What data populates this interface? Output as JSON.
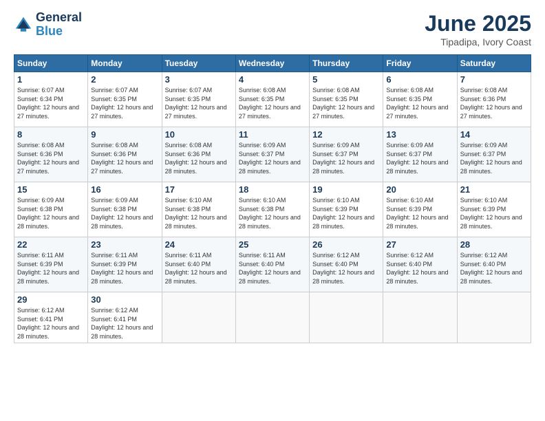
{
  "logo": {
    "line1": "General",
    "line2": "Blue"
  },
  "title": "June 2025",
  "subtitle": "Tipadipa, Ivory Coast",
  "days_of_week": [
    "Sunday",
    "Monday",
    "Tuesday",
    "Wednesday",
    "Thursday",
    "Friday",
    "Saturday"
  ],
  "weeks": [
    [
      {
        "day": "1",
        "sunrise": "6:07 AM",
        "sunset": "6:34 PM",
        "daylight": "12 hours and 27 minutes."
      },
      {
        "day": "2",
        "sunrise": "6:07 AM",
        "sunset": "6:35 PM",
        "daylight": "12 hours and 27 minutes."
      },
      {
        "day": "3",
        "sunrise": "6:07 AM",
        "sunset": "6:35 PM",
        "daylight": "12 hours and 27 minutes."
      },
      {
        "day": "4",
        "sunrise": "6:08 AM",
        "sunset": "6:35 PM",
        "daylight": "12 hours and 27 minutes."
      },
      {
        "day": "5",
        "sunrise": "6:08 AM",
        "sunset": "6:35 PM",
        "daylight": "12 hours and 27 minutes."
      },
      {
        "day": "6",
        "sunrise": "6:08 AM",
        "sunset": "6:35 PM",
        "daylight": "12 hours and 27 minutes."
      },
      {
        "day": "7",
        "sunrise": "6:08 AM",
        "sunset": "6:36 PM",
        "daylight": "12 hours and 27 minutes."
      }
    ],
    [
      {
        "day": "8",
        "sunrise": "6:08 AM",
        "sunset": "6:36 PM",
        "daylight": "12 hours and 27 minutes."
      },
      {
        "day": "9",
        "sunrise": "6:08 AM",
        "sunset": "6:36 PM",
        "daylight": "12 hours and 27 minutes."
      },
      {
        "day": "10",
        "sunrise": "6:08 AM",
        "sunset": "6:36 PM",
        "daylight": "12 hours and 28 minutes."
      },
      {
        "day": "11",
        "sunrise": "6:09 AM",
        "sunset": "6:37 PM",
        "daylight": "12 hours and 28 minutes."
      },
      {
        "day": "12",
        "sunrise": "6:09 AM",
        "sunset": "6:37 PM",
        "daylight": "12 hours and 28 minutes."
      },
      {
        "day": "13",
        "sunrise": "6:09 AM",
        "sunset": "6:37 PM",
        "daylight": "12 hours and 28 minutes."
      },
      {
        "day": "14",
        "sunrise": "6:09 AM",
        "sunset": "6:37 PM",
        "daylight": "12 hours and 28 minutes."
      }
    ],
    [
      {
        "day": "15",
        "sunrise": "6:09 AM",
        "sunset": "6:38 PM",
        "daylight": "12 hours and 28 minutes."
      },
      {
        "day": "16",
        "sunrise": "6:09 AM",
        "sunset": "6:38 PM",
        "daylight": "12 hours and 28 minutes."
      },
      {
        "day": "17",
        "sunrise": "6:10 AM",
        "sunset": "6:38 PM",
        "daylight": "12 hours and 28 minutes."
      },
      {
        "day": "18",
        "sunrise": "6:10 AM",
        "sunset": "6:38 PM",
        "daylight": "12 hours and 28 minutes."
      },
      {
        "day": "19",
        "sunrise": "6:10 AM",
        "sunset": "6:39 PM",
        "daylight": "12 hours and 28 minutes."
      },
      {
        "day": "20",
        "sunrise": "6:10 AM",
        "sunset": "6:39 PM",
        "daylight": "12 hours and 28 minutes."
      },
      {
        "day": "21",
        "sunrise": "6:10 AM",
        "sunset": "6:39 PM",
        "daylight": "12 hours and 28 minutes."
      }
    ],
    [
      {
        "day": "22",
        "sunrise": "6:11 AM",
        "sunset": "6:39 PM",
        "daylight": "12 hours and 28 minutes."
      },
      {
        "day": "23",
        "sunrise": "6:11 AM",
        "sunset": "6:39 PM",
        "daylight": "12 hours and 28 minutes."
      },
      {
        "day": "24",
        "sunrise": "6:11 AM",
        "sunset": "6:40 PM",
        "daylight": "12 hours and 28 minutes."
      },
      {
        "day": "25",
        "sunrise": "6:11 AM",
        "sunset": "6:40 PM",
        "daylight": "12 hours and 28 minutes."
      },
      {
        "day": "26",
        "sunrise": "6:12 AM",
        "sunset": "6:40 PM",
        "daylight": "12 hours and 28 minutes."
      },
      {
        "day": "27",
        "sunrise": "6:12 AM",
        "sunset": "6:40 PM",
        "daylight": "12 hours and 28 minutes."
      },
      {
        "day": "28",
        "sunrise": "6:12 AM",
        "sunset": "6:40 PM",
        "daylight": "12 hours and 28 minutes."
      }
    ],
    [
      {
        "day": "29",
        "sunrise": "6:12 AM",
        "sunset": "6:41 PM",
        "daylight": "12 hours and 28 minutes."
      },
      {
        "day": "30",
        "sunrise": "6:12 AM",
        "sunset": "6:41 PM",
        "daylight": "12 hours and 28 minutes."
      },
      null,
      null,
      null,
      null,
      null
    ]
  ]
}
